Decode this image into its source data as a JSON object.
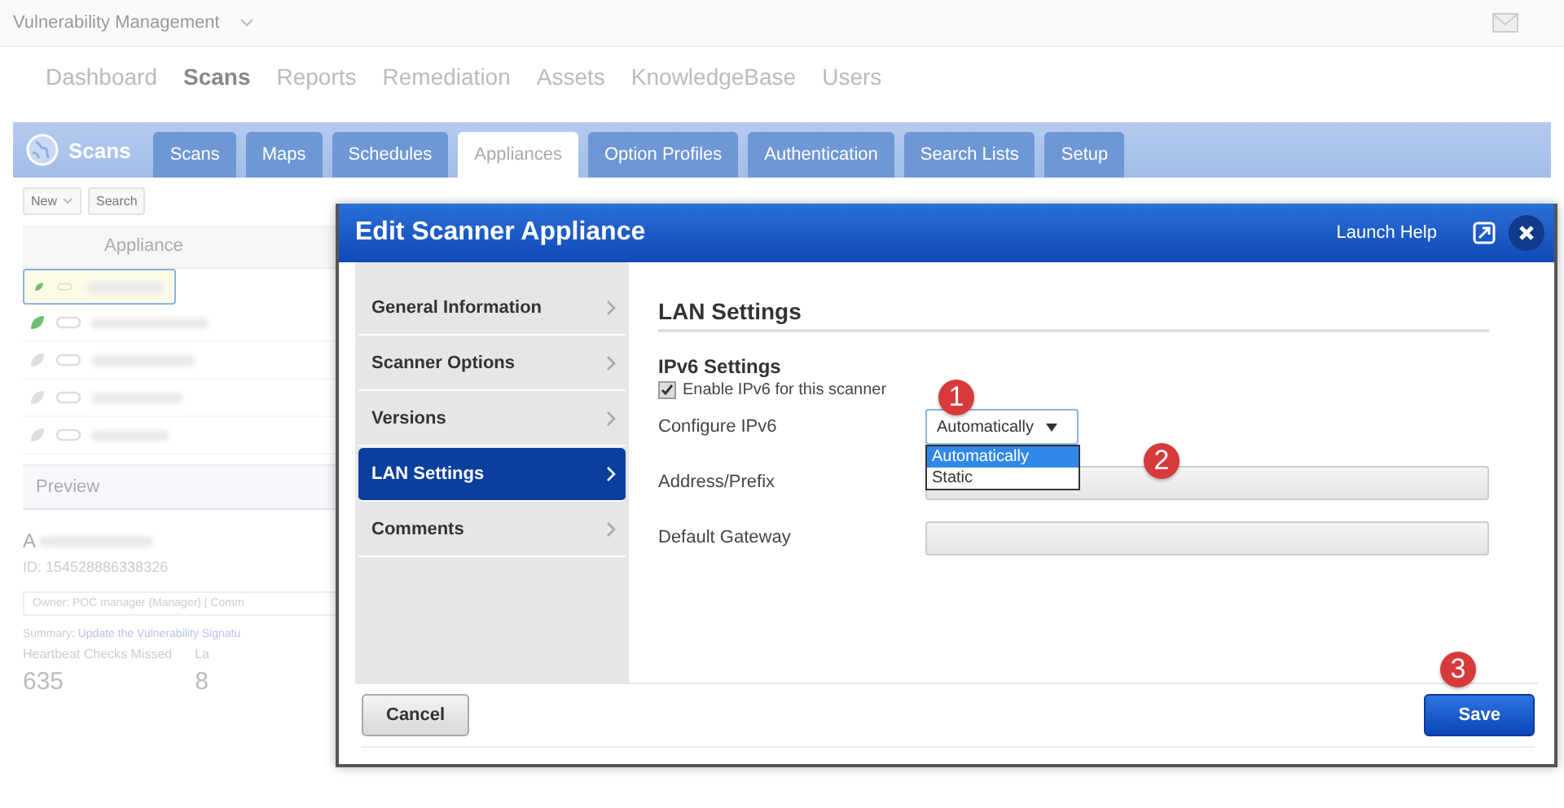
{
  "app": {
    "product": "Vulnerability Management",
    "nav": [
      {
        "label": "Dashboard",
        "selected": false
      },
      {
        "label": "Scans",
        "selected": true
      },
      {
        "label": "Reports",
        "selected": false
      },
      {
        "label": "Remediation",
        "selected": false
      },
      {
        "label": "Assets",
        "selected": false
      },
      {
        "label": "KnowledgeBase",
        "selected": false
      },
      {
        "label": "Users",
        "selected": false
      }
    ],
    "module_title": "Scans",
    "tabs": [
      {
        "label": "Scans",
        "selected": false
      },
      {
        "label": "Maps",
        "selected": false
      },
      {
        "label": "Schedules",
        "selected": false
      },
      {
        "label": "Appliances",
        "selected": true
      },
      {
        "label": "Option Profiles",
        "selected": false
      },
      {
        "label": "Authentication",
        "selected": false
      },
      {
        "label": "Search Lists",
        "selected": false
      },
      {
        "label": "Setup",
        "selected": false
      }
    ],
    "toolbar": [
      "New",
      "Search"
    ],
    "table": {
      "columns": [
        "Appliance"
      ],
      "rows": [
        {
          "selected": true,
          "active": true
        },
        {
          "selected": false,
          "active": true
        },
        {
          "selected": false,
          "active": false
        },
        {
          "selected": false,
          "active": false
        },
        {
          "selected": false,
          "active": false
        }
      ]
    },
    "preview": {
      "title": "Preview",
      "name": "A",
      "id": "ID: 154528886338326",
      "owner": "Owner: POC manager (Manager) | Comm",
      "summary_label": "Summary:",
      "summary_link": "Update the Vulnerability Signatu",
      "stats": [
        {
          "label": "Heartbeat Checks Missed",
          "value": "635"
        },
        {
          "label": "La",
          "value": "8"
        }
      ]
    }
  },
  "dialog": {
    "title": "Edit Scanner Appliance",
    "help": "Launch Help",
    "nav": [
      {
        "label": "General Information",
        "selected": false
      },
      {
        "label": "Scanner Options",
        "selected": false
      },
      {
        "label": "Versions",
        "selected": false
      },
      {
        "label": "LAN Settings",
        "selected": true
      },
      {
        "label": "Comments",
        "selected": false
      }
    ],
    "section": "LAN Settings",
    "subsection": "IPv6 Settings",
    "enable": {
      "label": "Enable IPv6 for this scanner",
      "checked": true
    },
    "fields": [
      {
        "label": "Configure IPv6",
        "kind": "select",
        "value": "Automatically",
        "expanded": true,
        "options": [
          {
            "label": "Automatically",
            "selected": true
          },
          {
            "label": "Static",
            "selected": false
          }
        ]
      },
      {
        "label": "Address/Prefix",
        "kind": "text"
      },
      {
        "label": "Default Gateway",
        "kind": "text"
      }
    ],
    "cancel": "Cancel",
    "save": "Save",
    "callouts": [
      "1",
      "2",
      "3"
    ]
  }
}
